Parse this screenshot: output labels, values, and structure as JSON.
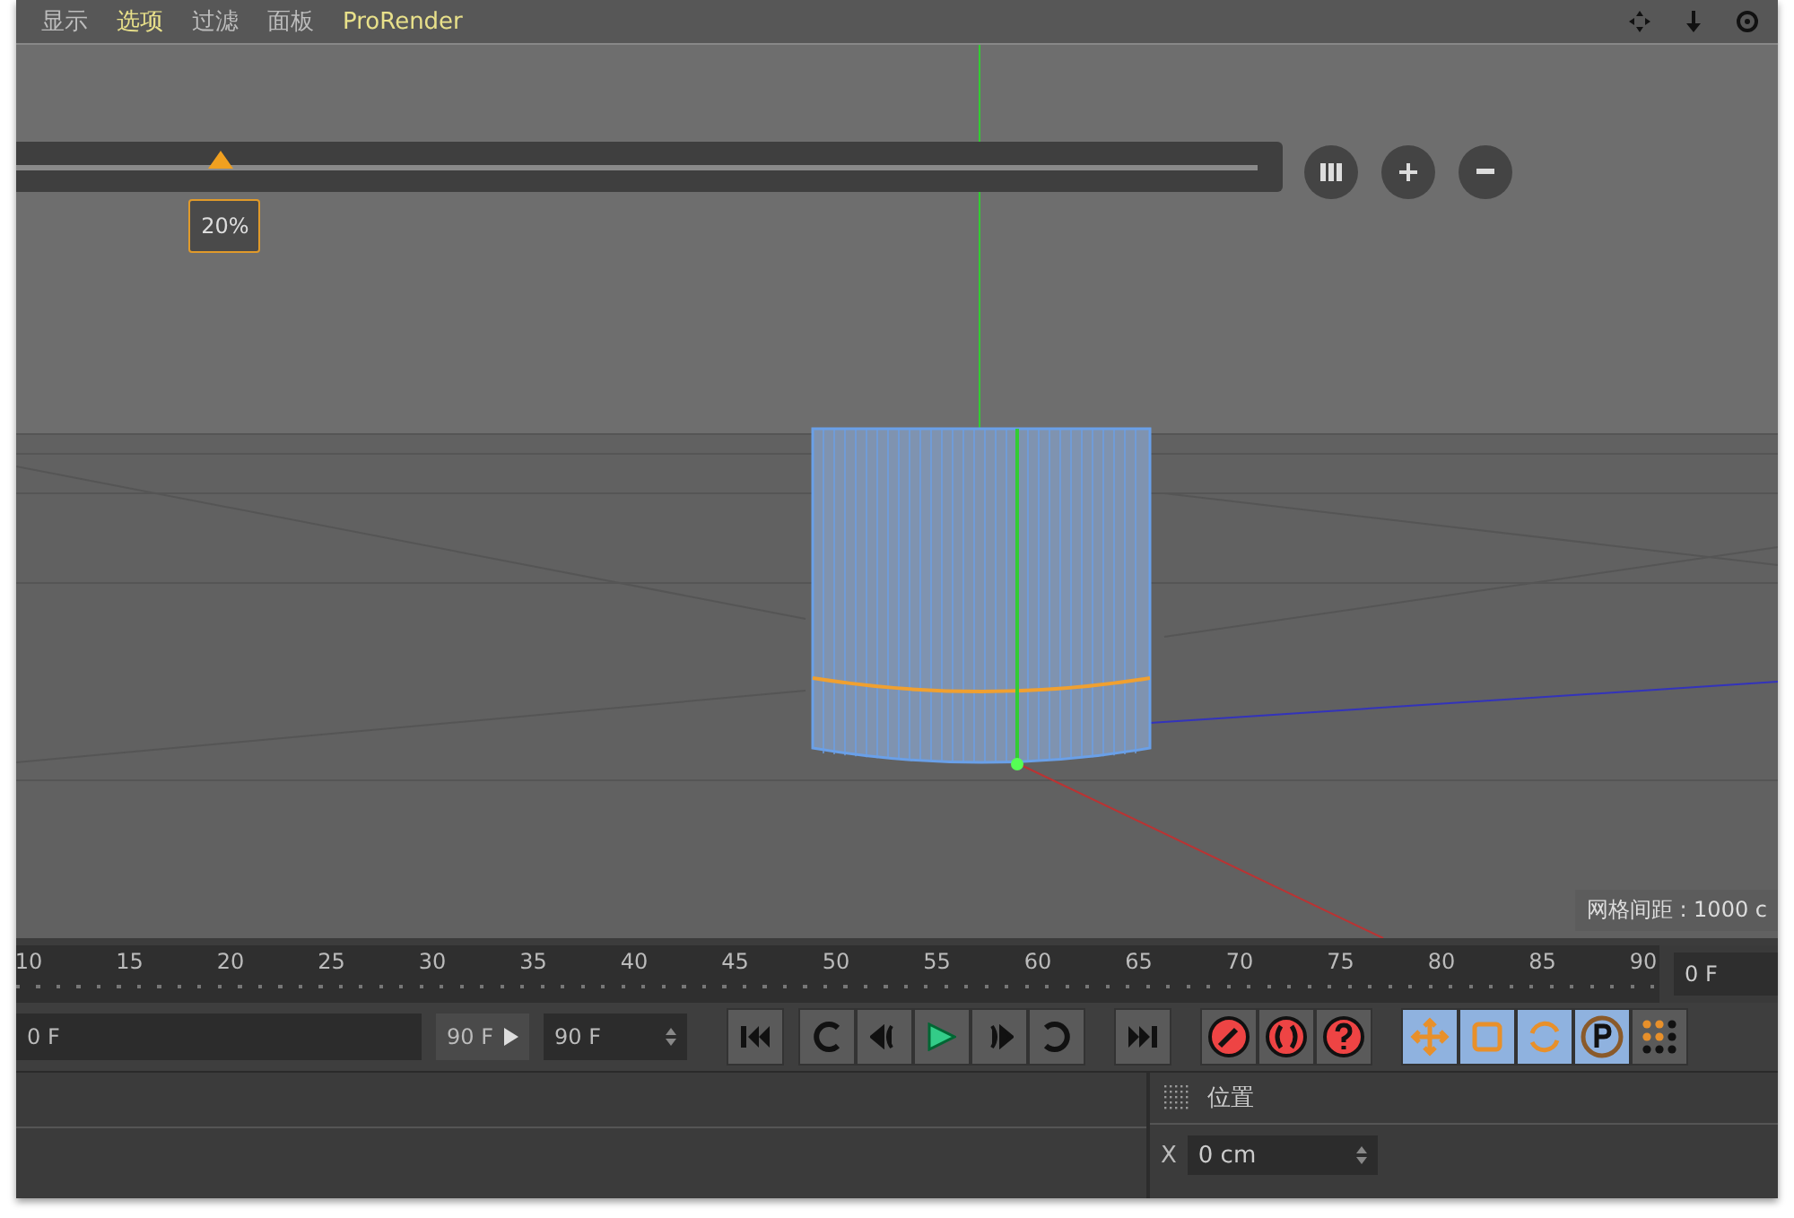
{
  "menu": [
    {
      "label": "显示",
      "highlight": false
    },
    {
      "label": "选项",
      "highlight": true
    },
    {
      "label": "过滤",
      "highlight": false
    },
    {
      "label": "面板",
      "highlight": false
    },
    {
      "label": "ProRender",
      "highlight": true
    }
  ],
  "slider": {
    "level": 0.165,
    "reading": "20%"
  },
  "grid_label": "网格间距 : 1000 c",
  "timeline": {
    "ticks": [
      "10",
      "15",
      "20",
      "25",
      "30",
      "35",
      "40",
      "45",
      "50",
      "55",
      "60",
      "65",
      "70",
      "75",
      "80",
      "85",
      "90"
    ],
    "current_frame": "0 F"
  },
  "transport": {
    "start": "0 F",
    "preview_end": "90 F",
    "end": "90 F"
  },
  "coordinates": {
    "title": "位置",
    "rows": [
      {
        "axis": "X",
        "value": "0 cm"
      }
    ]
  }
}
